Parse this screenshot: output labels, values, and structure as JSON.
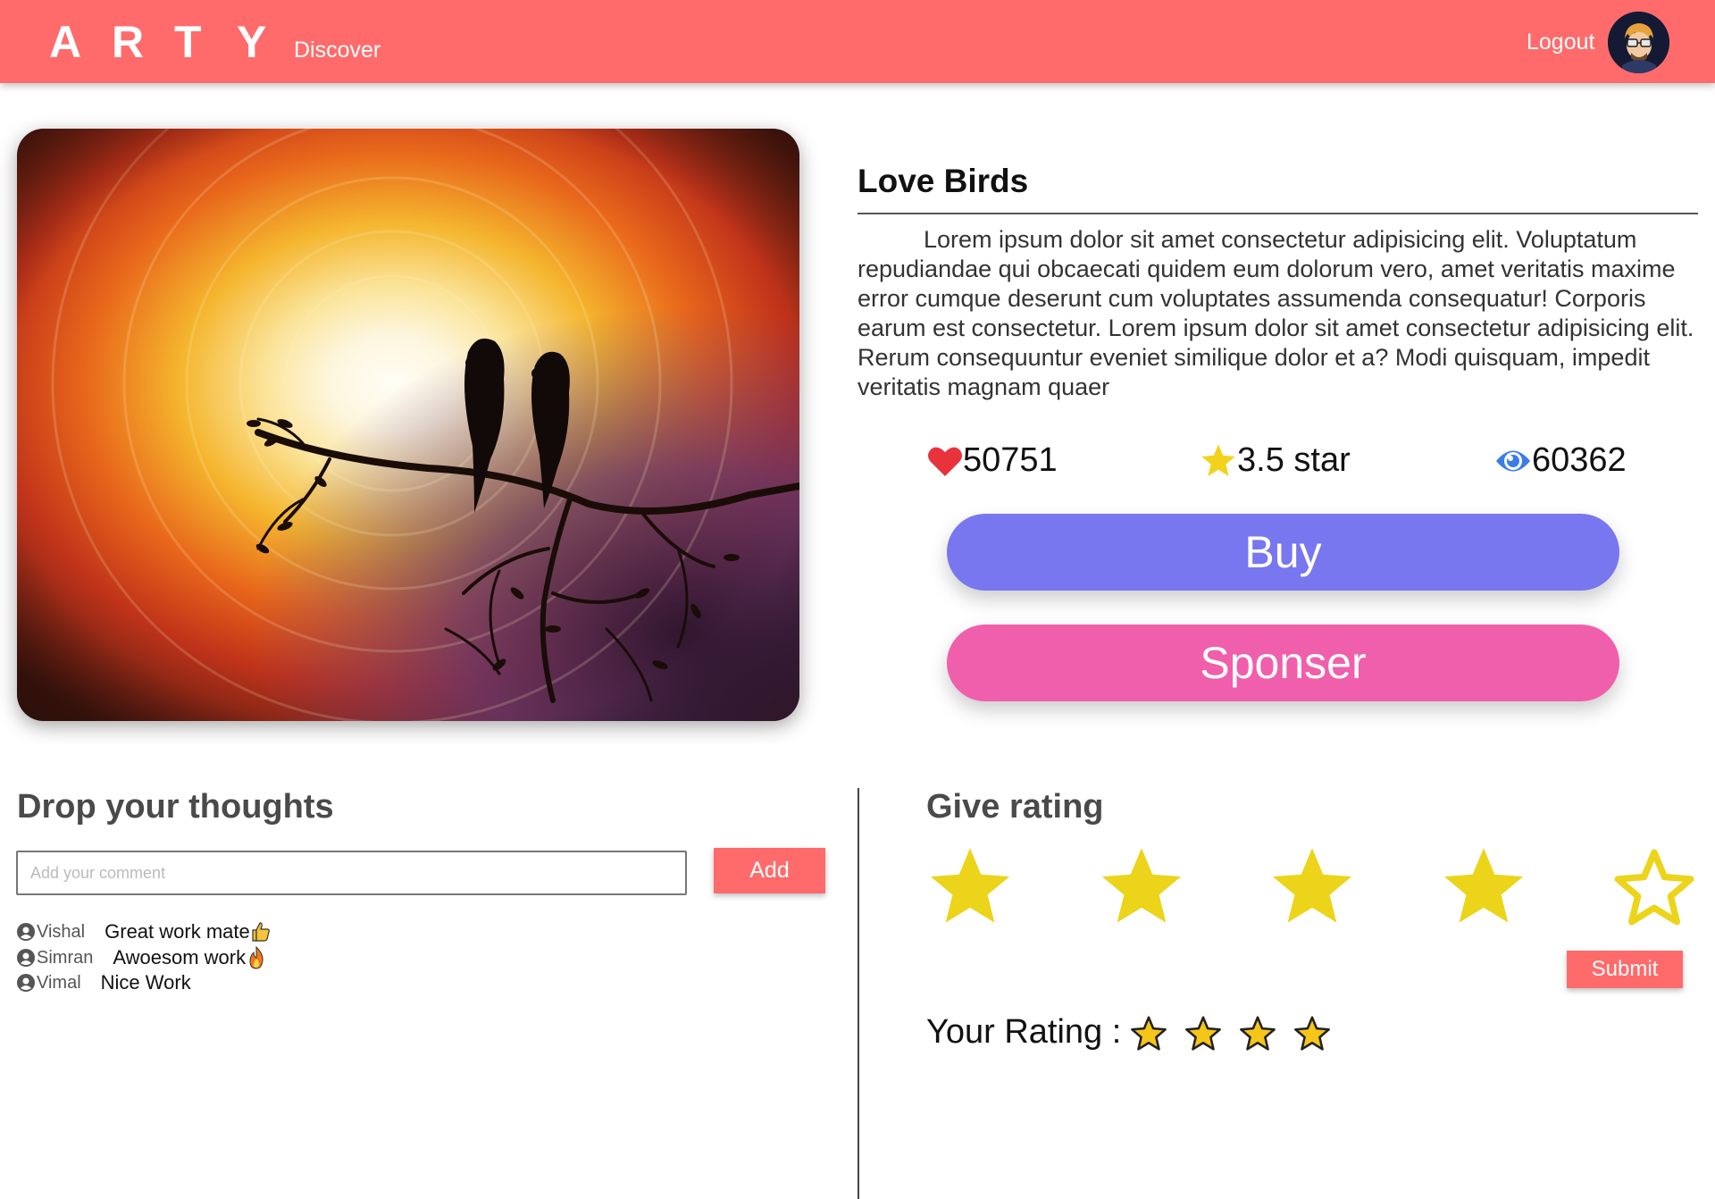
{
  "header": {
    "logo_letters": [
      "A",
      "R",
      "T",
      "Y"
    ],
    "nav_discover": "Discover",
    "logout": "Logout"
  },
  "art": {
    "title": "Love Birds",
    "description": "Lorem ipsum dolor sit amet consectetur adipisicing elit. Voluptatum repudiandae qui obcaecati quidem eum dolorum vero, amet veritatis maxime error cumque deserunt cum voluptates assumenda consequatur! Corporis earum est consectetur. Lorem ipsum dolor sit amet consectetur adipisicing elit. Rerum consequuntur eveniet similique dolor et a? Modi quisquam, impedit veritatis magnam quaer",
    "likes": "50751",
    "rating": "3.5 star",
    "views": "60362"
  },
  "actions": {
    "buy": "Buy",
    "sponser": "Sponser"
  },
  "comments_section": {
    "heading": "Drop your thoughts",
    "input_placeholder": "Add your comment",
    "add_button": "Add",
    "comments": [
      {
        "user": "Vishal",
        "text": "Great work mate",
        "emoji": "thumbs-up"
      },
      {
        "user": "Simran",
        "text": "Awoesom work",
        "emoji": "fire"
      },
      {
        "user": "Vimal",
        "text": "Nice Work",
        "emoji": ""
      }
    ]
  },
  "rating_section": {
    "heading": "Give rating",
    "stars_selected": 4,
    "stars_total": 5,
    "submit": "Submit",
    "your_rating_label": "Your Rating :",
    "your_rating_stars": 4
  },
  "colors": {
    "header": "#ff6b6b",
    "buy": "#7877ef",
    "sponser": "#f05fac",
    "star": "#ecd41a",
    "heart": "#e8333c",
    "eye": "#3b7ce8"
  },
  "icons": {
    "likes": "heart-icon",
    "rating": "star-icon",
    "views": "eye-icon",
    "user": "user-circle-icon"
  }
}
